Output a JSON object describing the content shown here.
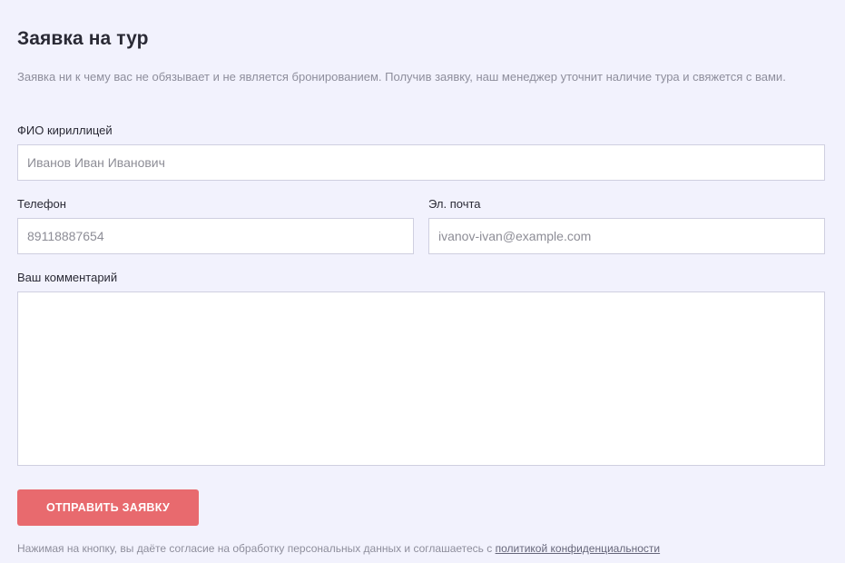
{
  "form": {
    "title": "Заявка на тур",
    "subtitle": "Заявка ни к чему вас не обязывает и не является бронированием. Получив заявку, наш менеджер уточнит наличие тура и свяжется с вами.",
    "full_name": {
      "label": "ФИО кириллицей",
      "placeholder": "Иванов Иван Иванович",
      "value": ""
    },
    "phone": {
      "label": "Телефон",
      "placeholder": "89118887654",
      "value": ""
    },
    "email": {
      "label": "Эл. почта",
      "placeholder": "ivanov-ivan@example.com",
      "value": ""
    },
    "comment": {
      "label": "Ваш комментарий",
      "value": ""
    },
    "submit_label": "ОТПРАВИТЬ ЗАЯВКУ",
    "consent_text": "Нажимая на кнопку, вы даёте согласие на обработку персональных данных и соглашаетесь с ",
    "privacy_link_label": "политикой конфиденциальности"
  },
  "colors": {
    "background": "#f2f2fd",
    "accent_button": "#e86a6e",
    "input_border": "#cfcfe0",
    "muted_text": "#8e8e9c"
  }
}
